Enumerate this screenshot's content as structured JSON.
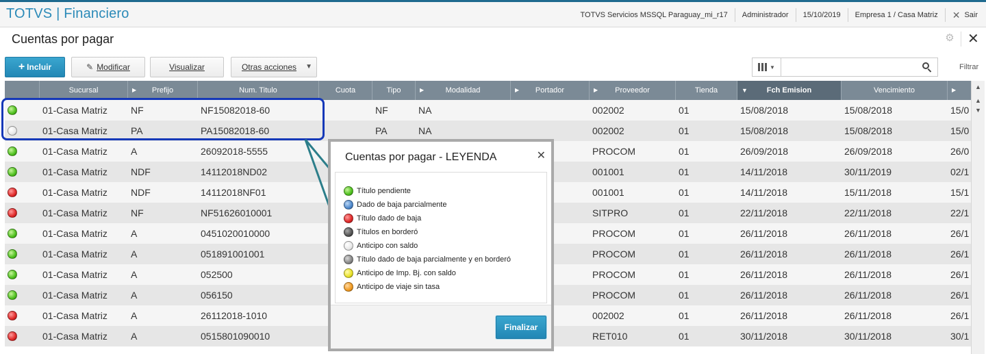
{
  "app": {
    "title": "TOTVS | Financiero",
    "server": "TOTVS Servicios MSSQL Paraguay_mi_r17",
    "user": "Administrador",
    "date": "15/10/2019",
    "company": "Empresa 1 / Casa Matriz",
    "logout_label": "Sair"
  },
  "page": {
    "title": "Cuentas por pagar"
  },
  "toolbar": {
    "include": "Incluir",
    "modify": "Modificar",
    "view": "Visualizar",
    "other": "Otras acciones",
    "filter_placeholder": "",
    "filter_label": "Filtrar"
  },
  "grid": {
    "columns": [
      "",
      "Sucursal",
      "Prefijo",
      "Num. Titulo",
      "Cuota",
      "Tipo",
      "Modalidad",
      "Portador",
      "Proveedor",
      "Tienda",
      "Fch Emision",
      "Vencimiento",
      ""
    ],
    "rows": [
      {
        "status": "green",
        "sucursal": "01-Casa Matriz",
        "prefijo": "NF",
        "num": "NF15082018-60",
        "cuota": "",
        "tipo": "NF",
        "modalidad": "NA",
        "portador": "",
        "proveedor": "002002",
        "tienda": "01",
        "emision": "15/08/2018",
        "venc": "15/08/2018",
        "extra": "15/0"
      },
      {
        "status": "white",
        "sucursal": "01-Casa Matriz",
        "prefijo": "PA",
        "num": "PA15082018-60",
        "cuota": "",
        "tipo": "PA",
        "modalidad": "NA",
        "portador": "",
        "proveedor": "002002",
        "tienda": "01",
        "emision": "15/08/2018",
        "venc": "15/08/2018",
        "extra": "15/0"
      },
      {
        "status": "green",
        "sucursal": "01-Casa Matriz",
        "prefijo": "A",
        "num": "26092018-5555",
        "cuota": "",
        "tipo": "",
        "modalidad": "",
        "portador": "",
        "proveedor": "PROCOM",
        "tienda": "01",
        "emision": "26/09/2018",
        "venc": "26/09/2018",
        "extra": "26/0"
      },
      {
        "status": "green",
        "sucursal": "01-Casa Matriz",
        "prefijo": "NDF",
        "num": "14112018ND02",
        "cuota": "",
        "tipo": "",
        "modalidad": "",
        "portador": "",
        "proveedor": "001001",
        "tienda": "01",
        "emision": "14/11/2018",
        "venc": "30/11/2019",
        "extra": "02/1"
      },
      {
        "status": "red",
        "sucursal": "01-Casa Matriz",
        "prefijo": "NDF",
        "num": "14112018NF01",
        "cuota": "",
        "tipo": "",
        "modalidad": "",
        "portador": "",
        "proveedor": "001001",
        "tienda": "01",
        "emision": "14/11/2018",
        "venc": "15/11/2018",
        "extra": "15/1"
      },
      {
        "status": "red",
        "sucursal": "01-Casa Matriz",
        "prefijo": "NF",
        "num": "NF51626010001",
        "cuota": "",
        "tipo": "",
        "modalidad": "",
        "portador": "",
        "proveedor": "SITPRO",
        "tienda": "01",
        "emision": "22/11/2018",
        "venc": "22/11/2018",
        "extra": "22/1"
      },
      {
        "status": "green",
        "sucursal": "01-Casa Matriz",
        "prefijo": "A",
        "num": "0451020010000",
        "cuota": "",
        "tipo": "",
        "modalidad": "",
        "portador": "",
        "proveedor": "PROCOM",
        "tienda": "01",
        "emision": "26/11/2018",
        "venc": "26/11/2018",
        "extra": "26/1"
      },
      {
        "status": "green",
        "sucursal": "01-Casa Matriz",
        "prefijo": "A",
        "num": "051891001001",
        "cuota": "",
        "tipo": "",
        "modalidad": "",
        "portador": "",
        "proveedor": "PROCOM",
        "tienda": "01",
        "emision": "26/11/2018",
        "venc": "26/11/2018",
        "extra": "26/1"
      },
      {
        "status": "green",
        "sucursal": "01-Casa Matriz",
        "prefijo": "A",
        "num": "052500",
        "cuota": "",
        "tipo": "",
        "modalidad": "",
        "portador": "",
        "proveedor": "PROCOM",
        "tienda": "01",
        "emision": "26/11/2018",
        "venc": "26/11/2018",
        "extra": "26/1"
      },
      {
        "status": "green",
        "sucursal": "01-Casa Matriz",
        "prefijo": "A",
        "num": "056150",
        "cuota": "",
        "tipo": "",
        "modalidad": "",
        "portador": "",
        "proveedor": "PROCOM",
        "tienda": "01",
        "emision": "26/11/2018",
        "venc": "26/11/2018",
        "extra": "26/1"
      },
      {
        "status": "red",
        "sucursal": "01-Casa Matriz",
        "prefijo": "A",
        "num": "26112018-1010",
        "cuota": "",
        "tipo": "",
        "modalidad": "",
        "portador": "",
        "proveedor": "002002",
        "tienda": "01",
        "emision": "26/11/2018",
        "venc": "26/11/2018",
        "extra": "26/1"
      },
      {
        "status": "red",
        "sucursal": "01-Casa Matriz",
        "prefijo": "A",
        "num": "0515801090010",
        "cuota": "",
        "tipo": "",
        "modalidad": "",
        "portador": "",
        "proveedor": "RET010",
        "tienda": "01",
        "emision": "30/11/2018",
        "venc": "30/11/2018",
        "extra": "30/1"
      }
    ]
  },
  "legend_dialog": {
    "title": "Cuentas por pagar - LEYENDA",
    "items": [
      {
        "color": "green",
        "label": "Título pendiente"
      },
      {
        "color": "blue",
        "label": "Dado de baja parcialmente"
      },
      {
        "color": "red",
        "label": "Título dado de baja"
      },
      {
        "color": "dark",
        "label": "Títulos en borderó"
      },
      {
        "color": "white",
        "label": "Anticipo con saldo"
      },
      {
        "color": "grey",
        "label": "Título dado de baja parcialmente y en borderó"
      },
      {
        "color": "yellow",
        "label": "Anticipo de Imp. Bj. con saldo"
      },
      {
        "color": "orange",
        "label": "Anticipo de viaje sin tasa"
      }
    ],
    "finish_label": "Finalizar"
  },
  "colors": {
    "brand": "#2b8ab8",
    "grid_header": "#7b8a96",
    "highlight": "#1538b8",
    "arrow": "#2c7e8a"
  }
}
